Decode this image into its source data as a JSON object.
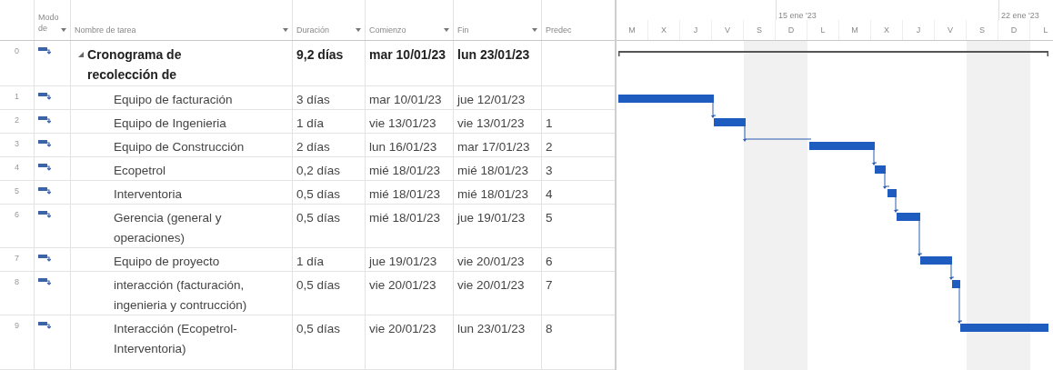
{
  "columns": [
    {
      "label": "Modo de"
    },
    {
      "label": "Nombre de tarea"
    },
    {
      "label": "Duración"
    },
    {
      "label": "Comienzo"
    },
    {
      "label": "Fin"
    },
    {
      "label": "Predec"
    }
  ],
  "timescale": {
    "weeks": [
      "15 ene '23",
      "22 ene '23"
    ],
    "days": [
      "M",
      "X",
      "J",
      "V",
      "S",
      "D",
      "L",
      "M",
      "X",
      "J",
      "V",
      "S",
      "D",
      "L"
    ]
  },
  "tasks": [
    {
      "id": "0",
      "name": "Cronograma de recolección de",
      "duration": "9,2 días",
      "start": "mar 10/01/23",
      "finish": "lun 23/01/23",
      "kind": "summary",
      "expanded": true
    },
    {
      "id": "1",
      "name": "Equipo de facturación",
      "duration": "3 días",
      "start": "mar 10/01/23",
      "finish": "jue 12/01/23",
      "kind": "task"
    },
    {
      "id": "2",
      "name": "Equipo de Ingenieria",
      "duration": "1 día",
      "start": "vie 13/01/23",
      "finish": "vie 13/01/23",
      "predecessor": "1",
      "kind": "task"
    },
    {
      "id": "3",
      "name": "Equipo de Construcción",
      "duration": "2 días",
      "start": "lun 16/01/23",
      "finish": "mar 17/01/23",
      "predecessor": "2",
      "kind": "task"
    },
    {
      "id": "4",
      "name": "Ecopetrol",
      "duration": "0,2 días",
      "start": "mié 18/01/23",
      "finish": "mié 18/01/23",
      "predecessor": "3",
      "kind": "task"
    },
    {
      "id": "5",
      "name": "Interventoria",
      "duration": "0,5 días",
      "start": "mié 18/01/23",
      "finish": "mié 18/01/23",
      "predecessor": "4",
      "kind": "task"
    },
    {
      "id": "6",
      "name": "Gerencia (general y operaciones)",
      "duration": "0,5 días",
      "start": "mié 18/01/23",
      "finish": "jue 19/01/23",
      "predecessor": "5",
      "kind": "task"
    },
    {
      "id": "7",
      "name": "Equipo de proyecto",
      "duration": "1 día",
      "start": "jue 19/01/23",
      "finish": "vie 20/01/23",
      "predecessor": "6",
      "kind": "task"
    },
    {
      "id": "8",
      "name": "interacción (facturación, ingenieria y contrucción)",
      "duration": "0,5 días",
      "start": "vie 20/01/23",
      "finish": "vie 20/01/23",
      "predecessor": "7",
      "kind": "task"
    },
    {
      "id": "9",
      "name": "Interacción (Ecopetrol-Interventoria)",
      "duration": "0,5 días",
      "start": "vie 20/01/23",
      "finish": "lun 23/01/23",
      "predecessor": "8",
      "kind": "task"
    }
  ]
}
